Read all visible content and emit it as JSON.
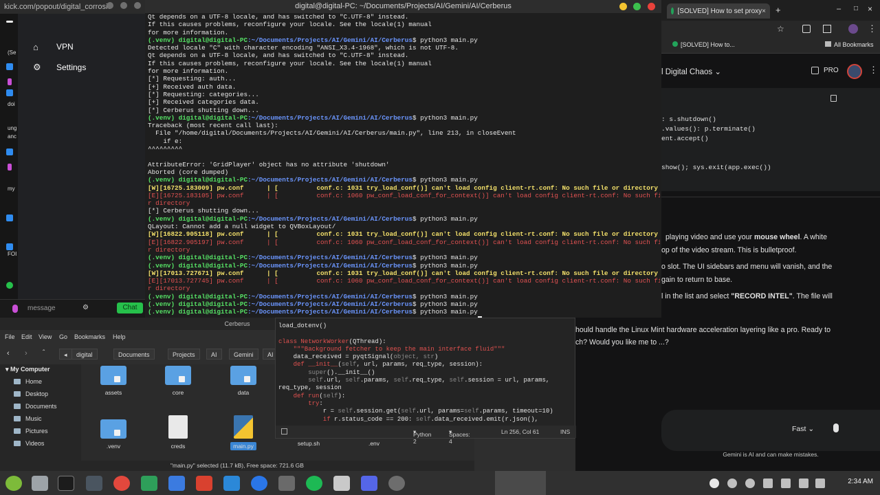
{
  "left_window": {
    "url": "kick.com/popout/digital_corrosio",
    "menu": [
      {
        "label": "VPN",
        "icon": "home-icon"
      },
      {
        "label": "Settings",
        "icon": "gear-icon"
      }
    ],
    "sidebar_snippets": [
      "(Se",
      "doi",
      "ung",
      "anc",
      "my",
      "FOI"
    ],
    "input_placeholder": "message",
    "chat_button": "Chat"
  },
  "terminal": {
    "title": "digital@digital-PC: ~/Documents/Projects/AI/Gemini/AI/Cerberus",
    "prompt_user": "(.venv) digital@digital-PC",
    "prompt_path": ":~/Documents/Projects/AI/Gemini/AI/Cerberus",
    "lines": [
      {
        "t": "plain",
        "text": "Qt depends on a UTF-8 locale, and has switched to \"C.UTF-8\" instead."
      },
      {
        "t": "plain",
        "text": "If this causes problems, reconfigure your locale. See the locale(1) manual"
      },
      {
        "t": "plain",
        "text": "for more information."
      },
      {
        "t": "prompt",
        "cmd": "$ python3 main.py"
      },
      {
        "t": "plain",
        "text": "Detected locale \"C\" with character encoding \"ANSI_X3.4-1968\", which is not UTF-8."
      },
      {
        "t": "plain",
        "text": "Qt depends on a UTF-8 locale, and has switched to \"C.UTF-8\" instead."
      },
      {
        "t": "plain",
        "text": "If this causes problems, reconfigure your locale. See the locale(1) manual"
      },
      {
        "t": "plain",
        "text": "for more information."
      },
      {
        "t": "plain",
        "text": "[*] Requesting: auth..."
      },
      {
        "t": "plain",
        "text": "[+] Received auth data."
      },
      {
        "t": "plain",
        "text": "[*] Requesting: categories..."
      },
      {
        "t": "plain",
        "text": "[+] Received categories data."
      },
      {
        "t": "plain",
        "text": "[*] Cerberus shutting down..."
      },
      {
        "t": "prompt",
        "cmd": "$ python3 main.py"
      },
      {
        "t": "plain",
        "text": "Traceback (most recent call last):"
      },
      {
        "t": "plain",
        "text": "  File \"/home/digital/Documents/Projects/AI/Gemini/AI/Cerberus/main.py\", line 213, in closeEvent"
      },
      {
        "t": "plain",
        "text": "    if e:"
      },
      {
        "t": "plain",
        "text": "^^^^^^^^^"
      },
      {
        "t": "plain",
        "text": ""
      },
      {
        "t": "plain",
        "text": "AttributeError: 'GridPlayer' object has no attribute 'shutdown'"
      },
      {
        "t": "plain",
        "text": "Aborted (core dumped)"
      },
      {
        "t": "prompt",
        "cmd": "$ python3 main.py"
      },
      {
        "t": "warn",
        "text": "[W][16725.183009] pw.conf      | [          conf.c: 1031 try_load_conf()] can't load config client-rt.conf: No such file or directory"
      },
      {
        "t": "err",
        "text": "[E][16725.183105] pw.conf      | [          conf.c: 1060 pw_conf_load_conf_for_context()] can't load config client-rt.conf: No such file o"
      },
      {
        "t": "err",
        "text": "r directory"
      },
      {
        "t": "plain",
        "text": "[*] Cerberus shutting down..."
      },
      {
        "t": "prompt",
        "cmd": "$ python3 main.py"
      },
      {
        "t": "plain",
        "text": "QLayout: Cannot add a null widget to QVBoxLayout/"
      },
      {
        "t": "warn",
        "text": "[W][16822.905118] pw.conf      | [          conf.c: 1031 try_load_conf()] can't load config client-rt.conf: No such file or directory"
      },
      {
        "t": "err",
        "text": "[E][16822.905197] pw.conf      | [          conf.c: 1060 pw_conf_load_conf_for_context()] can't load config client-rt.conf: No such file o"
      },
      {
        "t": "err",
        "text": "r directory"
      },
      {
        "t": "prompt",
        "cmd": "$ python3 main.py"
      },
      {
        "t": "prompt",
        "cmd": "$ python3 main.py"
      },
      {
        "t": "warn",
        "text": "[W][17013.727671] pw.conf      | [          conf.c: 1031 try_load_conf()] can't load config client-rt.conf: No such file or directory"
      },
      {
        "t": "err",
        "text": "[E][17013.727745] pw.conf      | [          conf.c: 1060 pw_conf_load_conf_for_context()] can't load config client-rt.conf: No such file o"
      },
      {
        "t": "err",
        "text": "r directory"
      },
      {
        "t": "prompt",
        "cmd": "$ python3 main.py"
      },
      {
        "t": "prompt",
        "cmd": "$ python3 main.py"
      },
      {
        "t": "prompt",
        "cmd": "$ python3 main.py"
      },
      {
        "t": "prompt",
        "cmd": "$ python3 main.py",
        "cursor": true
      }
    ]
  },
  "chrome": {
    "tab_title": "[SOLVED] How to set proxy",
    "bookmark": "[SOLVED] How to...",
    "all_bookmarks": "All Bookmarks",
    "gem_title": "l Digital Chaos",
    "pro_label": "PRO",
    "code_lines": [
      ": s.shutdown()",
      ".values(): p.terminate()",
      "ent.accept()",
      "",
      "",
      "show(); sys.exit(app.exec())"
    ],
    "text_lines": [
      {
        "pre": "playing video and use your ",
        "bold": "mouse wheel",
        "post": ". A white"
      },
      {
        "pre": "op of the video stream. This is bulletproof.",
        "bold": "",
        "post": ""
      },
      {
        "pre": "o slot. The UI sidebars and menu will vanish, and the",
        "bold": "",
        "post": ""
      },
      {
        "pre": "gain to return to base.",
        "bold": "",
        "post": ""
      },
      {
        "pre": "l in the list and select ",
        "bold": "\"RECORD INTEL\"",
        "post": ". The file will"
      }
    ],
    "text_lines2": [
      "hould handle the Linux Mint hardware acceleration layering like a pro. Ready to",
      "ch? Would you like me to ...?"
    ],
    "model_label": "Fast",
    "footer": "Gemini is AI and can make mistakes."
  },
  "file_manager": {
    "title": "Cerberus",
    "menus": [
      "File",
      "Edit",
      "View",
      "Go",
      "Bookmarks",
      "Help"
    ],
    "breadcrumbs": [
      "digital",
      "Documents",
      "Projects",
      "AI",
      "Gemini",
      "AI"
    ],
    "sidebar_header": "My Computer",
    "sidebar_items": [
      "Home",
      "Desktop",
      "Documents",
      "Music",
      "Pictures",
      "Videos"
    ],
    "files": [
      {
        "name": "assets",
        "kind": "folder"
      },
      {
        "name": "core",
        "kind": "folder"
      },
      {
        "name": "data",
        "kind": "folder"
      },
      {
        "name": ".venv",
        "kind": "folder"
      },
      {
        "name": "creds",
        "kind": "doc"
      },
      {
        "name": "main.py",
        "kind": "python"
      },
      {
        "name": "setup.sh",
        "kind": "doc"
      },
      {
        "name": ".env",
        "kind": "doc"
      }
    ],
    "status": "\"main.py\" selected (11.7 kB), Free space: 721.6 GB"
  },
  "editor": {
    "lines": [
      [
        {
          "c": "k-white",
          "t": "load_dotenv()"
        }
      ],
      [
        {
          "c": "k-white",
          "t": ""
        }
      ],
      [
        {
          "c": "k-red",
          "t": "class "
        },
        {
          "c": "k-red",
          "t": "NetworkWorker"
        },
        {
          "c": "k-white",
          "t": "(QThread):"
        }
      ],
      [
        {
          "c": "k-red",
          "t": "    \"\"\"Background fetcher to keep the main interface fluid\"\"\""
        }
      ],
      [
        {
          "c": "k-white",
          "t": "    data_received = pyqtSignal("
        },
        {
          "c": "k-grey",
          "t": "object, str"
        },
        {
          "c": "k-white",
          "t": ")"
        }
      ],
      [
        {
          "c": "k-red",
          "t": "    def "
        },
        {
          "c": "k-red",
          "t": "__init__"
        },
        {
          "c": "k-white",
          "t": "("
        },
        {
          "c": "k-grey",
          "t": "self"
        },
        {
          "c": "k-white",
          "t": ", url, params, req_type, session):"
        }
      ],
      [
        {
          "c": "k-grey",
          "t": "        super"
        },
        {
          "c": "k-white",
          "t": "().__init__()"
        }
      ],
      [
        {
          "c": "k-grey",
          "t": "        self"
        },
        {
          "c": "k-white",
          "t": ".url, "
        },
        {
          "c": "k-grey",
          "t": "self"
        },
        {
          "c": "k-white",
          "t": ".params, "
        },
        {
          "c": "k-grey",
          "t": "self"
        },
        {
          "c": "k-white",
          "t": ".req_type, "
        },
        {
          "c": "k-grey",
          "t": "self"
        },
        {
          "c": "k-white",
          "t": ".session = url, params,"
        }
      ],
      [
        {
          "c": "k-white",
          "t": "req_type, session"
        }
      ],
      [
        {
          "c": "k-red",
          "t": "    def "
        },
        {
          "c": "k-red",
          "t": "run"
        },
        {
          "c": "k-white",
          "t": "("
        },
        {
          "c": "k-grey",
          "t": "self"
        },
        {
          "c": "k-white",
          "t": "):"
        }
      ],
      [
        {
          "c": "k-red",
          "t": "        try"
        },
        {
          "c": "k-white",
          "t": ":"
        }
      ],
      [
        {
          "c": "k-white",
          "t": "            r = "
        },
        {
          "c": "k-grey",
          "t": "self"
        },
        {
          "c": "k-white",
          "t": ".session.get("
        },
        {
          "c": "k-grey",
          "t": "self"
        },
        {
          "c": "k-white",
          "t": ".url, params="
        },
        {
          "c": "k-grey",
          "t": "self"
        },
        {
          "c": "k-white",
          "t": ".params, timeout=10)"
        }
      ],
      [
        {
          "c": "k-red",
          "t": "            if "
        },
        {
          "c": "k-white",
          "t": "r.status_code == 200: "
        },
        {
          "c": "k-grey",
          "t": "self"
        },
        {
          "c": "k-white",
          "t": ".data_received.emit(r.json(),"
        }
      ]
    ],
    "language": "Python 2",
    "spaces": "Spaces: 4",
    "position": "Ln 256, Col 61",
    "mode": "INS"
  },
  "taskbar": {
    "time": "2:34 AM"
  },
  "colors": {
    "terminal_bg": "#1e1e1e",
    "prompt_green": "#56e366",
    "path_blue": "#6b96ff",
    "warn_yellow": "#f3e06a",
    "err_red": "#e35252",
    "chat_green": "#26c04b"
  }
}
